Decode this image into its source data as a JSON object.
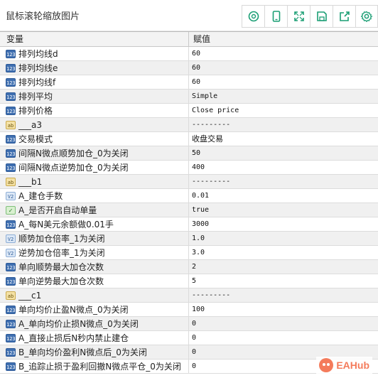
{
  "window": {
    "title": "鼠标滚轮缩放图片"
  },
  "toolbar": {
    "buttons": [
      {
        "icon": "zoom-search-icon"
      },
      {
        "icon": "phone-icon"
      },
      {
        "icon": "expand-icon"
      },
      {
        "icon": "save-icon"
      },
      {
        "icon": "share-icon"
      },
      {
        "icon": "settings-icon"
      }
    ]
  },
  "table": {
    "headers": {
      "variable": "变量",
      "value": "赋值"
    },
    "rows": [
      {
        "type": "int",
        "icon_text": "123",
        "name": "排列均线d",
        "value": "60"
      },
      {
        "type": "int",
        "icon_text": "123",
        "name": "排列均线e",
        "value": "60"
      },
      {
        "type": "int",
        "icon_text": "123",
        "name": "排列均线f",
        "value": "60"
      },
      {
        "type": "int",
        "icon_text": "123",
        "name": "排列平均",
        "value": "Simple"
      },
      {
        "type": "int",
        "icon_text": "123",
        "name": "排列价格",
        "value": "Close price"
      },
      {
        "type": "str",
        "icon_text": "ab",
        "name": "___a3",
        "value": "---------"
      },
      {
        "type": "int",
        "icon_text": "123",
        "name": "交易模式",
        "value": "收盘交易"
      },
      {
        "type": "int",
        "icon_text": "123",
        "name": "间隔N微点顺势加仓_0为关闭",
        "value": "50"
      },
      {
        "type": "int",
        "icon_text": "123",
        "name": "间隔N微点逆势加仓_0为关闭",
        "value": "400"
      },
      {
        "type": "str",
        "icon_text": "ab",
        "name": "___b1",
        "value": "---------"
      },
      {
        "type": "dbl",
        "icon_text": "V2",
        "name": "A_建仓手数",
        "value": "0.01"
      },
      {
        "type": "bool",
        "icon_text": "✓",
        "name": "A_是否开启自动单量",
        "value": "true"
      },
      {
        "type": "int",
        "icon_text": "123",
        "name": "A_每N美元余额做0.01手",
        "value": "3000"
      },
      {
        "type": "dbl",
        "icon_text": "V2",
        "name": "顺势加仓倍率_1为关闭",
        "value": "1.0"
      },
      {
        "type": "dbl",
        "icon_text": "V2",
        "name": "逆势加仓倍率_1为关闭",
        "value": "3.0"
      },
      {
        "type": "int",
        "icon_text": "123",
        "name": "单向顺势最大加仓次数",
        "value": "2"
      },
      {
        "type": "int",
        "icon_text": "123",
        "name": "单向逆势最大加仓次数",
        "value": "5"
      },
      {
        "type": "str",
        "icon_text": "ab",
        "name": "___c1",
        "value": "---------"
      },
      {
        "type": "int",
        "icon_text": "123",
        "name": "单向均价止盈N微点_0为关闭",
        "value": "100"
      },
      {
        "type": "int",
        "icon_text": "123",
        "name": "A_单向均价止损N微点_0为关闭",
        "value": "0"
      },
      {
        "type": "int",
        "icon_text": "123",
        "name": "A_直接止损后N秒内禁止建仓",
        "value": "0"
      },
      {
        "type": "int",
        "icon_text": "123",
        "name": "B_单向均价盈利N微点后_0为关闭",
        "value": "0"
      },
      {
        "type": "int",
        "icon_text": "123",
        "name": "B_追踪止损于盈利回撤N微点平仓_0为关闭",
        "value": "0"
      }
    ]
  },
  "watermark": {
    "text": "EAHub"
  },
  "colors": {
    "accent": "#1a9e74",
    "watermark": "#f47b5b"
  }
}
